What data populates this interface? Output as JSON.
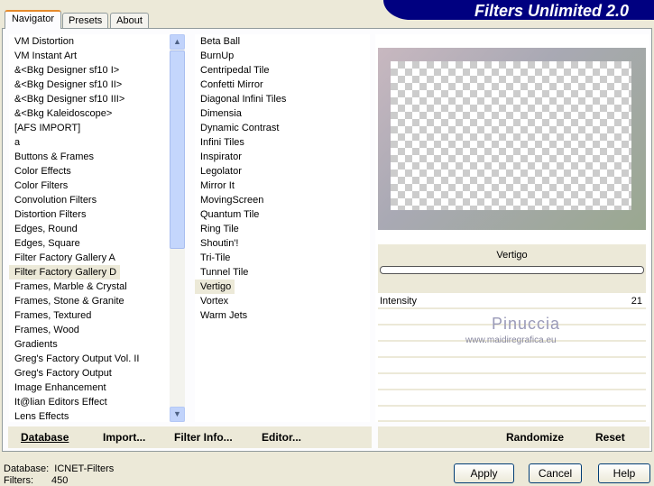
{
  "title": "Filters Unlimited 2.0",
  "tabs": [
    "Navigator",
    "Presets",
    "About"
  ],
  "categories": [
    "VM Distortion",
    "VM Instant Art",
    "&<Bkg Designer sf10 I>",
    "&<Bkg Designer sf10 II>",
    "&<Bkg Designer sf10 III>",
    "&<Bkg Kaleidoscope>",
    "[AFS IMPORT]",
    "a",
    "Buttons & Frames",
    "Color Effects",
    "Color Filters",
    "Convolution Filters",
    "Distortion Filters",
    "Edges, Round",
    "Edges, Square",
    "Filter Factory Gallery A",
    "Filter Factory Gallery D",
    "Frames, Marble & Crystal",
    "Frames, Stone & Granite",
    "Frames, Textured",
    "Frames, Wood",
    "Gradients",
    "Greg's Factory Output Vol. II",
    "Greg's Factory Output",
    "Image Enhancement",
    "It@lian Editors Effect",
    "Lens Effects"
  ],
  "selected_category_index": 16,
  "filters": [
    "Beta Ball",
    "BurnUp",
    "Centripedal Tile",
    "Confetti Mirror",
    "Diagonal Infini Tiles",
    "Dimensia",
    "Dynamic Contrast",
    "Infini Tiles",
    "Inspirator",
    "Legolator",
    "Mirror It",
    "MovingScreen",
    "Quantum Tile",
    "Ring Tile",
    "Shoutin'!",
    "Tri-Tile",
    "Tunnel Tile",
    "Vertigo",
    "Vortex",
    "Warm Jets"
  ],
  "selected_filter_index": 17,
  "filter_name": "Vertigo",
  "params": [
    {
      "label": "Intensity",
      "value": "21"
    }
  ],
  "watermark": {
    "name": "Pinuccia",
    "url": "www.maidiregrafica.eu"
  },
  "left_buttons": [
    "Database",
    "Import...",
    "Filter Info...",
    "Editor..."
  ],
  "right_buttons": [
    "Randomize",
    "Reset"
  ],
  "status": {
    "database_label": "Database:",
    "database_value": "ICNET-Filters",
    "filters_label": "Filters:",
    "filters_value": "450"
  },
  "dialog_buttons": [
    "Apply",
    "Cancel",
    "Help"
  ]
}
